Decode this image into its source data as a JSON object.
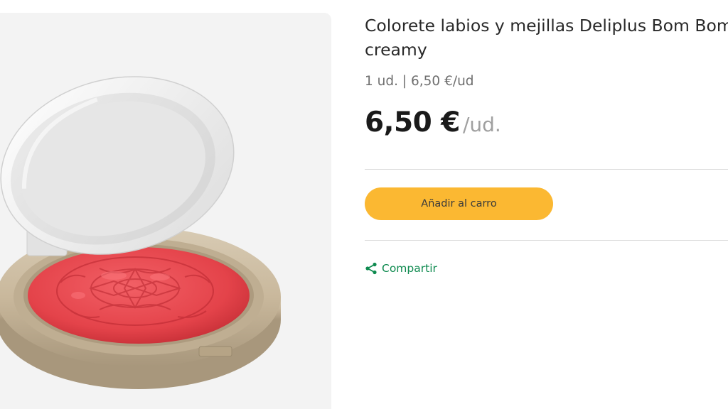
{
  "product": {
    "title": "Colorete labios y mejillas Deliplus Bom Bom creamy",
    "unit_info": "1 ud. | 6,50 €/ud",
    "price": "6,50 €",
    "price_unit": "/ud.",
    "add_to_cart_label": "Añadir al carro",
    "share_label": "Compartir",
    "image_icon": "blush-compact-image"
  },
  "colors": {
    "accent_button": "#fbb832",
    "share_green": "#0e8a4f",
    "blush_red": "#e8444a"
  }
}
